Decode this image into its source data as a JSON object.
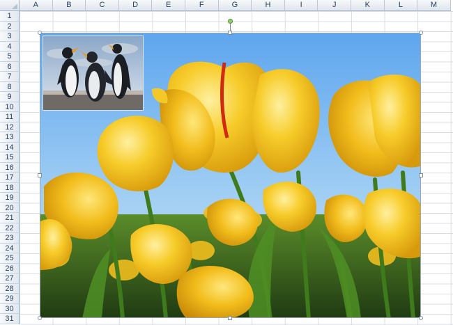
{
  "columns": [
    "A",
    "B",
    "C",
    "D",
    "E",
    "F",
    "G",
    "H",
    "I",
    "J",
    "K",
    "L",
    "M"
  ],
  "rows": [
    "1",
    "2",
    "3",
    "4",
    "5",
    "6",
    "7",
    "8",
    "9",
    "10",
    "11",
    "12",
    "13",
    "14",
    "15",
    "16",
    "17",
    "18",
    "19",
    "20",
    "21",
    "22",
    "23",
    "24",
    "25",
    "26",
    "27",
    "28",
    "29",
    "30",
    "31"
  ],
  "pictures": {
    "main": "tulips-image",
    "inset": "penguins-image"
  },
  "colors": {
    "header_text": "#27415f",
    "grid_line": "#d8dde3",
    "tulip_yellow": "#f4c21b",
    "sky_blue": "#7db7ea",
    "rotation_handle": "#8ed16a"
  }
}
